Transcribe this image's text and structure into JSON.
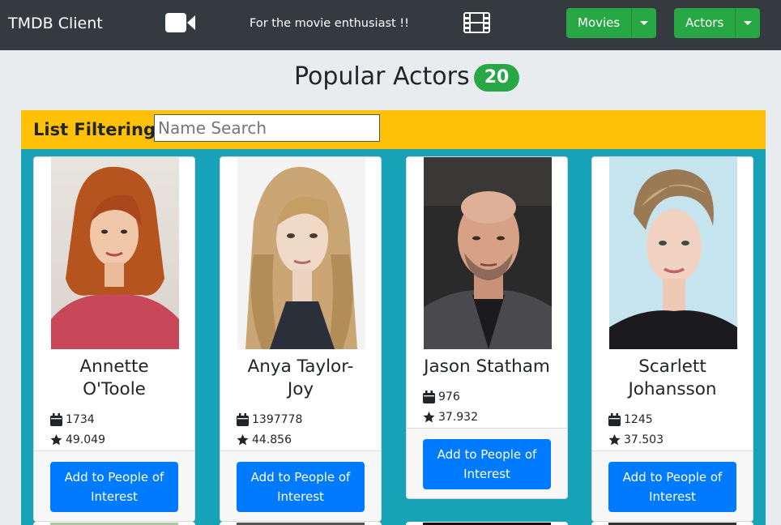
{
  "navbar": {
    "brand": "TMDB Client",
    "tagline": "For the movie enthusiast !!",
    "movies_label": "Movies",
    "actors_label": "Actors",
    "bg_color": "#343a40",
    "button_color": "#28a745"
  },
  "heading": {
    "title": "Popular Actors",
    "count": "20"
  },
  "filter": {
    "label": "List Filtering:",
    "placeholder": "Name Search",
    "value": ""
  },
  "cards": [
    {
      "name": "Annette O'Toole",
      "name_line1": "Annette",
      "name_line2": "O'Toole",
      "known_for_count": "1734",
      "popularity": "49.049",
      "button_label_line1": "Add to People of",
      "button_label_line2": "Interest"
    },
    {
      "name": "Anya Taylor-Joy",
      "name_line1": "Anya Taylor-",
      "name_line2": "Joy",
      "known_for_count": "1397778",
      "popularity": "44.856",
      "button_label_line1": "Add to People of",
      "button_label_line2": "Interest"
    },
    {
      "name": "Jason Statham",
      "name_line1": "Jason Statham",
      "known_for_count": "976",
      "popularity": "37.932",
      "button_label_line1": "Add to People of",
      "button_label_line2": "Interest"
    },
    {
      "name": "Scarlett Johansson",
      "name_line1": "Scarlett",
      "name_line2": "Johansson",
      "known_for_count": "1245",
      "popularity": "37.503",
      "button_label_line1": "Add to People of",
      "button_label_line2": "Interest"
    }
  ],
  "colors": {
    "filter_bar": "#ffc107",
    "grid_bg": "#17a2b8",
    "primary_button": "#007bff",
    "badge": "#28a745"
  },
  "icons": {
    "camera": "video-camera-icon",
    "film": "film-icon",
    "calendar": "calendar-icon",
    "star": "star-icon"
  }
}
